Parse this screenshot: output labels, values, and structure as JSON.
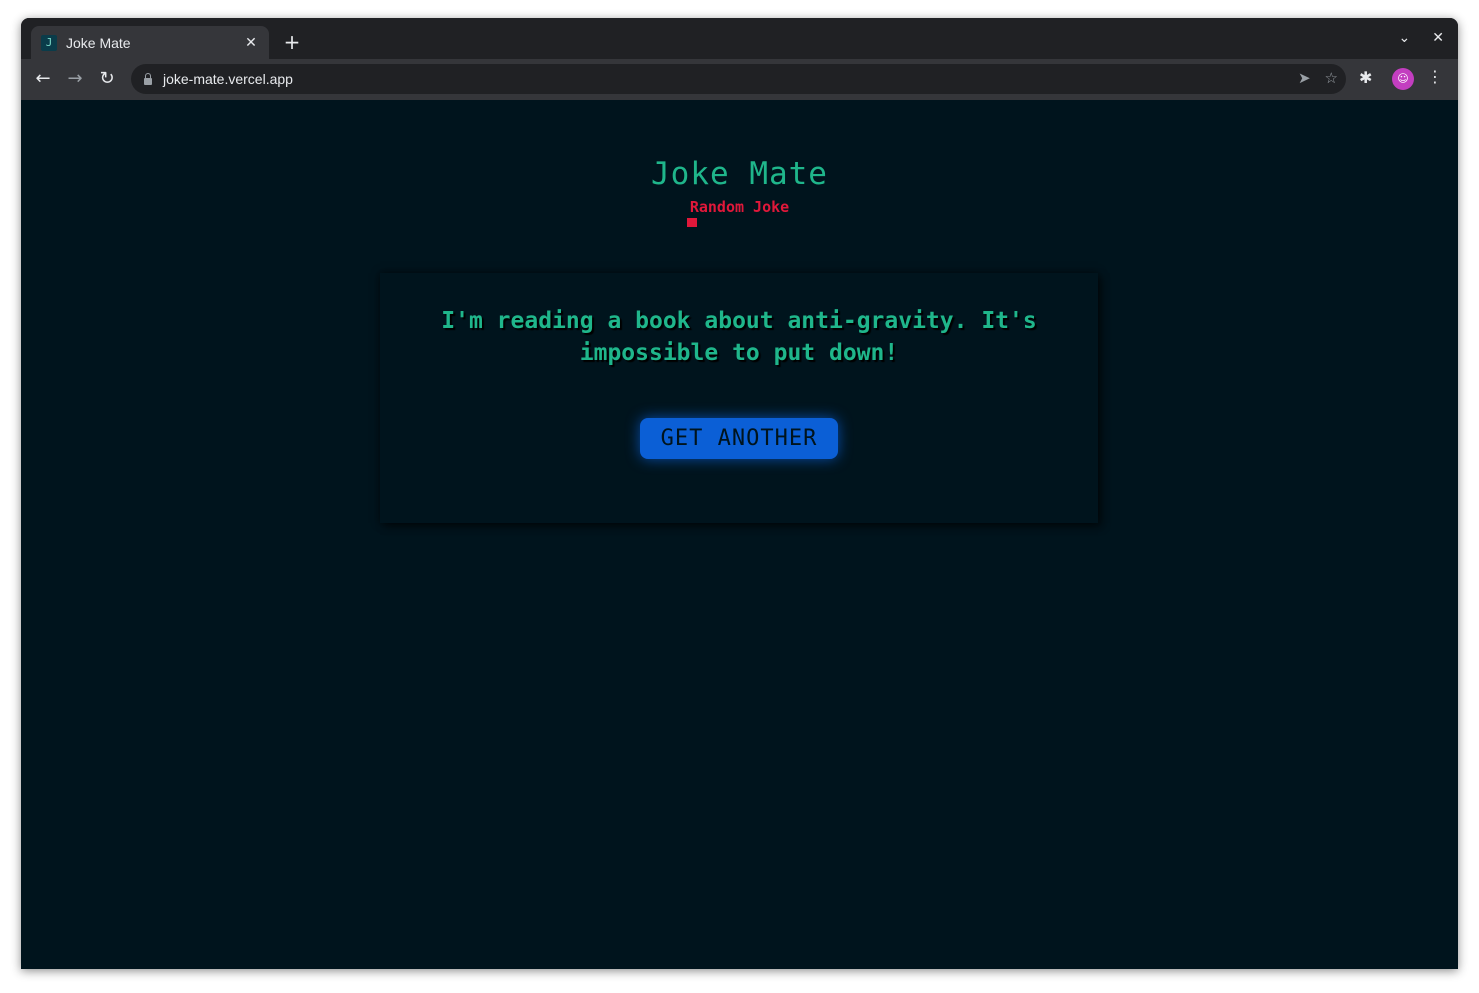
{
  "browser": {
    "tab_title": "Joke Mate",
    "favicon_letter": "J",
    "tab_close": "✕",
    "new_tab": "+",
    "tab_list": "⌄",
    "window_close": "✕",
    "url": "joke-mate.vercel.app",
    "nav": {
      "back": "←",
      "forward": "→",
      "reload": "↻"
    },
    "omnibox_icons": {
      "send": "➤",
      "bookmark": "☆"
    },
    "extensions_icon": "✱",
    "avatar_glyph": "☺",
    "menu": "⋮"
  },
  "page": {
    "title": "Joke Mate",
    "subtitle": "Random Joke",
    "joke_text": "I'm reading a book about anti-gravity. It's impossible to put down!",
    "button_label": "GET ANOTHER"
  },
  "colors": {
    "background": "#00141d",
    "accent_green": "#1fb68b",
    "accent_red": "#e0183a",
    "button_blue": "#0b5fd6"
  }
}
